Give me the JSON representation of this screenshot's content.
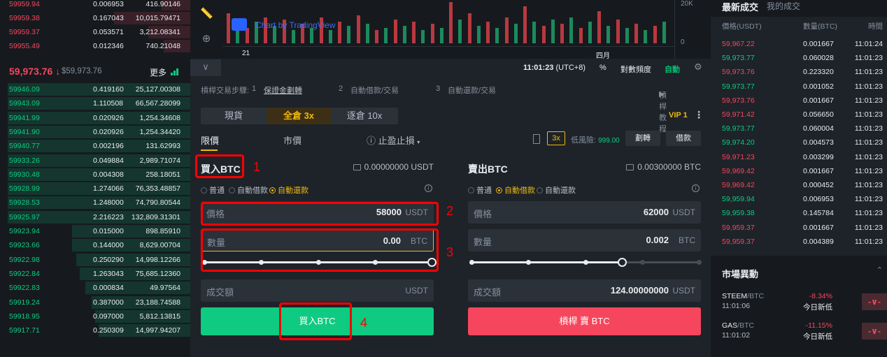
{
  "orderbook": {
    "asks": [
      {
        "price": "59959.94",
        "amount": "0.006953",
        "total": "416.90146",
        "depth": 0.15
      },
      {
        "price": "59959.38",
        "amount": "0.167043",
        "total": "10,015.79471",
        "depth": 0.4
      },
      {
        "price": "59959.37",
        "amount": "0.053571",
        "total": "3,212.08341",
        "depth": 0.22
      },
      {
        "price": "59955.49",
        "amount": "0.012346",
        "total": "740.21048",
        "depth": 0.14
      }
    ],
    "last_price": "59,973.76",
    "arrow": "↓",
    "mark_price": "$59,973.76",
    "more_label": "更多",
    "bids": [
      {
        "price": "59946.09",
        "amount": "0.419160",
        "total": "25,127.00308",
        "depth": 0.96
      },
      {
        "price": "59943.09",
        "amount": "1.110508",
        "total": "66,567.28099",
        "depth": 0.96
      },
      {
        "price": "59941.99",
        "amount": "0.020926",
        "total": "1,254.34608",
        "depth": 0.96
      },
      {
        "price": "59941.90",
        "amount": "0.020926",
        "total": "1,254.34420",
        "depth": 0.96
      },
      {
        "price": "59940.77",
        "amount": "0.002196",
        "total": "131.62993",
        "depth": 0.96
      },
      {
        "price": "59933.26",
        "amount": "0.049884",
        "total": "2,989.71074",
        "depth": 0.96
      },
      {
        "price": "59930.48",
        "amount": "0.004308",
        "total": "258.18051",
        "depth": 0.96
      },
      {
        "price": "59928.99",
        "amount": "1.274066",
        "total": "76,353.48857",
        "depth": 0.96
      },
      {
        "price": "59928.53",
        "amount": "1.248000",
        "total": "74,790.80544",
        "depth": 0.96
      },
      {
        "price": "59925.97",
        "amount": "2.216223",
        "total": "132,809.31301",
        "depth": 0.96
      },
      {
        "price": "59923.94",
        "amount": "0.015000",
        "total": "898.85910",
        "depth": 0.62
      },
      {
        "price": "59923.66",
        "amount": "0.144000",
        "total": "8,629.00704",
        "depth": 0.62
      },
      {
        "price": "59922.98",
        "amount": "0.250290",
        "total": "14,998.12266",
        "depth": 0.6
      },
      {
        "price": "59922.84",
        "amount": "1.263043",
        "total": "75,685.12360",
        "depth": 0.58
      },
      {
        "price": "59922.83",
        "amount": "0.000834",
        "total": "49.97564",
        "depth": 0.55
      },
      {
        "price": "59919.24",
        "amount": "0.387000",
        "total": "23,188.74588",
        "depth": 0.52
      },
      {
        "price": "59918.95",
        "amount": "0.097000",
        "total": "5,812.13815",
        "depth": 0.5
      },
      {
        "price": "59917.71",
        "amount": "0.250309",
        "total": "14,997.94207",
        "depth": 0.48
      }
    ]
  },
  "chart": {
    "tv_label": "Chart by TradingView",
    "x_ticks": [
      "21",
      "四月"
    ],
    "y_ticks": [
      "20K",
      "0"
    ],
    "volume": [
      {
        "v": 0.7,
        "c": "r"
      },
      {
        "v": 0.45,
        "c": "g"
      },
      {
        "v": 0.35,
        "c": "r"
      },
      {
        "v": 0.5,
        "c": "g"
      },
      {
        "v": 0.6,
        "c": "r"
      },
      {
        "v": 0.4,
        "c": "g"
      },
      {
        "v": 0.55,
        "c": "r"
      },
      {
        "v": 0.3,
        "c": "g"
      },
      {
        "v": 0.45,
        "c": "r"
      },
      {
        "v": 0.35,
        "c": "g"
      },
      {
        "v": 0.6,
        "c": "r"
      },
      {
        "v": 0.3,
        "c": "g"
      },
      {
        "v": 0.5,
        "c": "r"
      },
      {
        "v": 0.4,
        "c": "g"
      },
      {
        "v": 0.65,
        "c": "r"
      },
      {
        "v": 0.45,
        "c": "g"
      },
      {
        "v": 0.3,
        "c": "r"
      },
      {
        "v": 0.35,
        "c": "g"
      },
      {
        "v": 0.55,
        "c": "r"
      },
      {
        "v": 0.4,
        "c": "g"
      },
      {
        "v": 0.5,
        "c": "r"
      },
      {
        "v": 0.3,
        "c": "g"
      },
      {
        "v": 0.45,
        "c": "r"
      },
      {
        "v": 0.35,
        "c": "g"
      },
      {
        "v": 0.95,
        "c": "r"
      },
      {
        "v": 0.55,
        "c": "g"
      },
      {
        "v": 0.7,
        "c": "r"
      },
      {
        "v": 0.4,
        "c": "g"
      },
      {
        "v": 0.5,
        "c": "r"
      },
      {
        "v": 0.35,
        "c": "g"
      },
      {
        "v": 0.6,
        "c": "r"
      },
      {
        "v": 0.45,
        "c": "g"
      },
      {
        "v": 0.85,
        "c": "r"
      },
      {
        "v": 0.5,
        "c": "g"
      },
      {
        "v": 0.4,
        "c": "r"
      },
      {
        "v": 0.55,
        "c": "g"
      },
      {
        "v": 0.45,
        "c": "r"
      },
      {
        "v": 0.6,
        "c": "g"
      },
      {
        "v": 0.35,
        "c": "r"
      },
      {
        "v": 0.5,
        "c": "g"
      },
      {
        "v": 0.75,
        "c": "r"
      },
      {
        "v": 0.4,
        "c": "g"
      },
      {
        "v": 0.55,
        "c": "r"
      },
      {
        "v": 0.35,
        "c": "g"
      },
      {
        "v": 0.45,
        "c": "r"
      },
      {
        "v": 0.3,
        "c": "g"
      },
      {
        "v": 0.4,
        "c": "r"
      },
      {
        "v": 0.5,
        "c": "g"
      }
    ],
    "time": "11:01:23",
    "tz": "(UTC+8)",
    "pct": "%",
    "log": "對數頻度",
    "auto": "自動"
  },
  "steps": {
    "label": "槓桿交易步驟:",
    "s1_num": "1",
    "s1": "保證金劃轉",
    "s2_num": "2",
    "s2": "自動借款/交易",
    "s3_num": "3",
    "s3": "自動還款/交易",
    "tutorial": "槓桿教程"
  },
  "margin_tabs": {
    "spot": "現貨",
    "cross": "全倉 3x",
    "isolated": "逐倉 10x"
  },
  "vip": "VIP 1",
  "order_tabs": {
    "limit": "限價",
    "market": "市價",
    "stop": "止盈止損"
  },
  "leverage": "3x",
  "risk_label": "低風險:",
  "risk_value": "999.00",
  "transfer_btn": "劃轉",
  "borrow_btn": "借款",
  "buy": {
    "title": "買入BTC",
    "balance": "0.00000000 USDT",
    "modes": [
      "普通",
      "自動借款",
      "自動還款"
    ],
    "price_label": "價格",
    "price": "58000",
    "price_unit": "USDT",
    "qty_label": "數量",
    "qty": "0.00",
    "qty_unit": "BTC",
    "slider": 1.0,
    "total_label": "成交額",
    "total": "",
    "total_unit": "USDT",
    "button": "買入BTC"
  },
  "sell": {
    "title": "賣出BTC",
    "balance": "0.00300000 BTC",
    "modes": [
      "普通",
      "自動借款",
      "自動還款"
    ],
    "price_label": "價格",
    "price": "62000",
    "price_unit": "USDT",
    "qty_label": "數量",
    "qty": "0.002",
    "qty_unit": "BTC",
    "slider": 0.66,
    "total_label": "成交額",
    "total": "124.00000000",
    "total_unit": "USDT",
    "button": "槓桿 賣 BTC"
  },
  "callouts": [
    "1",
    "2",
    "3",
    "4"
  ],
  "trades": {
    "tab_market": "最新成交",
    "tab_mine": "我的成交",
    "col_price": "價格(USDT)",
    "col_amount": "數量(BTC)",
    "col_time": "時間",
    "rows": [
      {
        "p": "59,967.22",
        "a": "0.001667",
        "t": "11:01:24",
        "c": "r"
      },
      {
        "p": "59,973.77",
        "a": "0.060028",
        "t": "11:01:23",
        "c": "g"
      },
      {
        "p": "59,973.76",
        "a": "0.223320",
        "t": "11:01:23",
        "c": "r"
      },
      {
        "p": "59,973.77",
        "a": "0.001052",
        "t": "11:01:23",
        "c": "g"
      },
      {
        "p": "59,973.76",
        "a": "0.001667",
        "t": "11:01:23",
        "c": "r"
      },
      {
        "p": "59,971.42",
        "a": "0.056650",
        "t": "11:01:23",
        "c": "r"
      },
      {
        "p": "59,973.77",
        "a": "0.060004",
        "t": "11:01:23",
        "c": "g"
      },
      {
        "p": "59,974.20",
        "a": "0.004573",
        "t": "11:01:23",
        "c": "g"
      },
      {
        "p": "59,971.23",
        "a": "0.003299",
        "t": "11:01:23",
        "c": "r"
      },
      {
        "p": "59,969.42",
        "a": "0.001667",
        "t": "11:01:23",
        "c": "r"
      },
      {
        "p": "59,969.42",
        "a": "0.000452",
        "t": "11:01:23",
        "c": "r"
      },
      {
        "p": "59,959.94",
        "a": "0.006953",
        "t": "11:01:23",
        "c": "g"
      },
      {
        "p": "59,959.38",
        "a": "0.145784",
        "t": "11:01:23",
        "c": "g"
      },
      {
        "p": "59,959.37",
        "a": "0.001667",
        "t": "11:01:23",
        "c": "r"
      },
      {
        "p": "59,959.37",
        "a": "0.004389",
        "t": "11:01:23",
        "c": "r"
      }
    ]
  },
  "movers": {
    "title": "市場異動",
    "rows": [
      {
        "base": "STEEM",
        "quote": "/BTC",
        "time": "11:01:06",
        "chg": "-8.34%",
        "label": "今日新低",
        "tag": "-∨-"
      },
      {
        "base": "GAS",
        "quote": "/BTC",
        "time": "11:01:02",
        "chg": "-11.15%",
        "label": "今日新低",
        "tag": "-∨-"
      }
    ]
  },
  "colors": {
    "up": "#0ecb81",
    "down": "#f6465d",
    "accent": "#f0b90b",
    "callout": "#ff0000"
  }
}
